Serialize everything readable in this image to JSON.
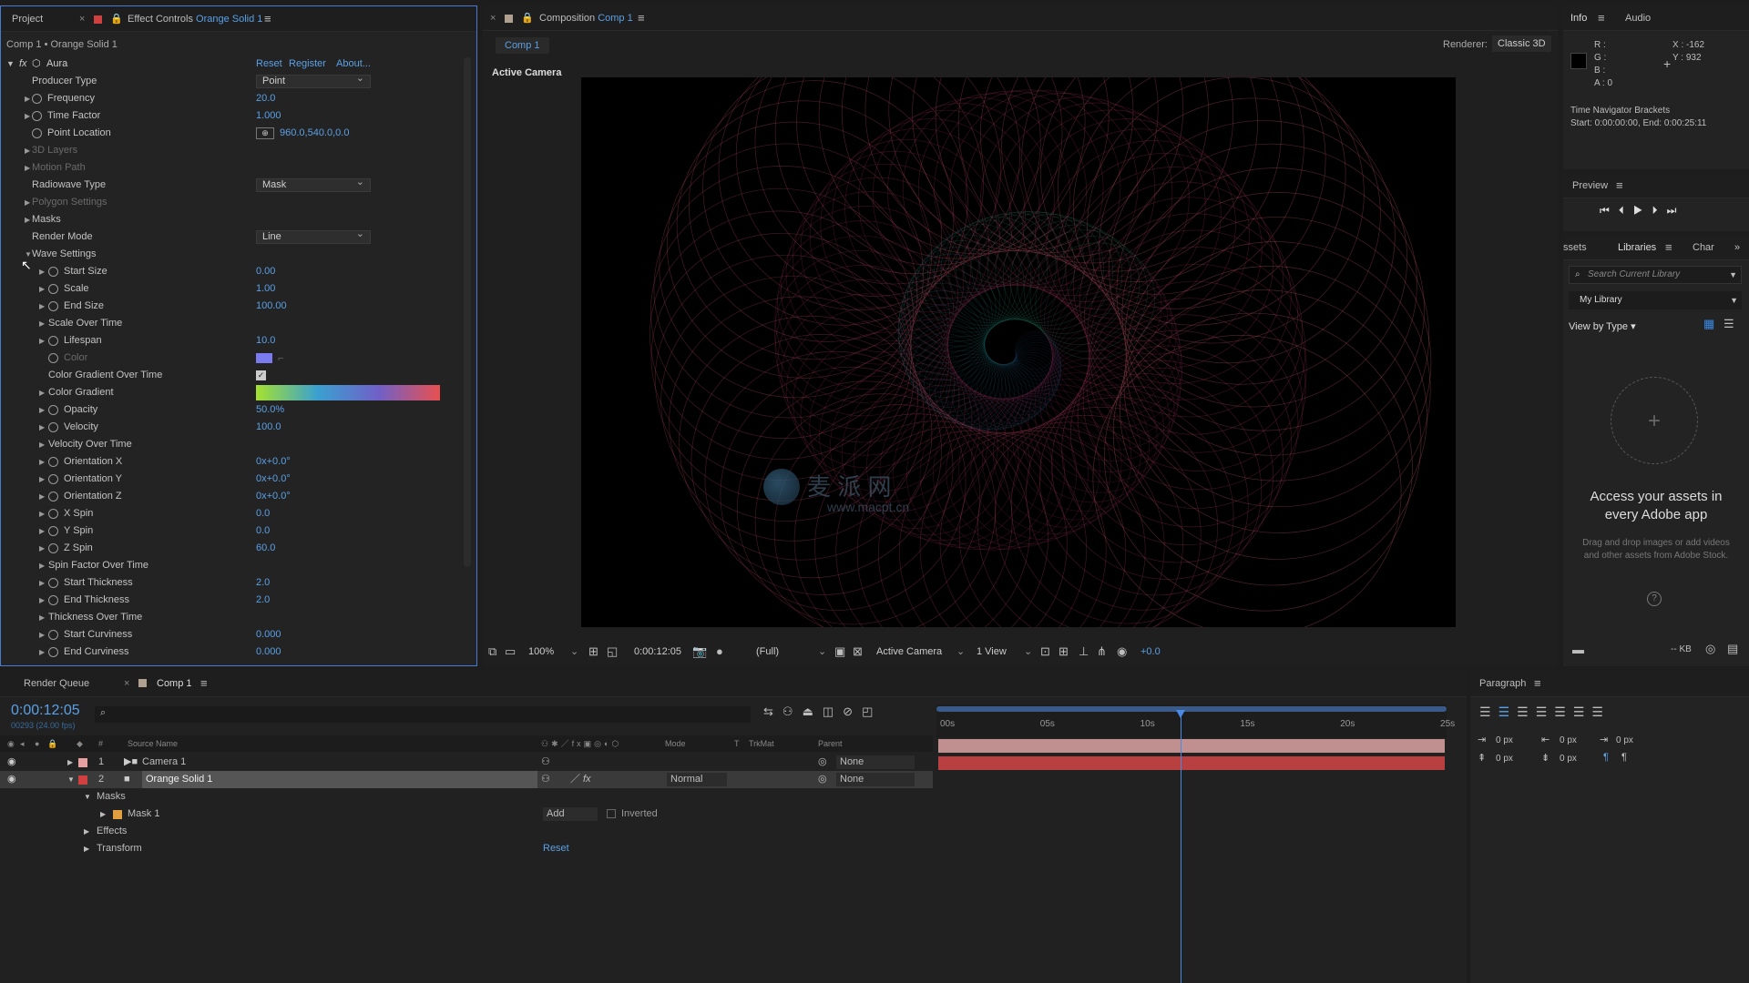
{
  "effect_controls": {
    "tab_project": "Project",
    "tab_title": "Effect Controls",
    "tab_layer": "Orange Solid 1",
    "breadcrumb": "Comp 1 • Orange Solid 1",
    "fx_label": "fx",
    "effect_name": "Aura",
    "reset": "Reset",
    "register": "Register",
    "about": "About...",
    "rows": [
      {
        "name": "Producer Type",
        "dropdown": "Point"
      },
      {
        "name": "Frequency",
        "value": "20.0"
      },
      {
        "name": "Time Factor",
        "value": "1.000"
      },
      {
        "name": "Point Location",
        "value": "960.0,540.0,0.0"
      },
      {
        "name": "3D Layers"
      },
      {
        "name": "Motion Path"
      },
      {
        "name": "Radiowave Type",
        "dropdown": "Mask"
      },
      {
        "name": "Polygon Settings"
      },
      {
        "name": "Masks"
      },
      {
        "name": "Render Mode",
        "dropdown": "Line"
      },
      {
        "name": "Wave Settings"
      },
      {
        "name": "Start Size",
        "value": "0.00"
      },
      {
        "name": "Scale",
        "value": "1.00"
      },
      {
        "name": "End Size",
        "value": "100.00"
      },
      {
        "name": "Scale Over Time"
      },
      {
        "name": "Lifespan",
        "value": "10.0"
      },
      {
        "name": "Color"
      },
      {
        "name": "Color Gradient Over Time"
      },
      {
        "name": "Color Gradient"
      },
      {
        "name": "Opacity",
        "value": "50.0%"
      },
      {
        "name": "Velocity",
        "value": "100.0"
      },
      {
        "name": "Velocity Over Time"
      },
      {
        "name": "Orientation X",
        "value": "0x+0.0°"
      },
      {
        "name": "Orientation Y",
        "value": "0x+0.0°"
      },
      {
        "name": "Orientation Z",
        "value": "0x+0.0°"
      },
      {
        "name": "X Spin",
        "value": "0.0"
      },
      {
        "name": "Y Spin",
        "value": "0.0"
      },
      {
        "name": "Z Spin",
        "value": "60.0"
      },
      {
        "name": "Spin Factor Over Time"
      },
      {
        "name": "Start Thickness",
        "value": "2.0"
      },
      {
        "name": "End Thickness",
        "value": "2.0"
      },
      {
        "name": "Thickness Over Time"
      },
      {
        "name": "Start Curviness",
        "value": "0.000"
      },
      {
        "name": "End Curviness",
        "value": "0.000"
      }
    ],
    "color_swatch": "#7b7bf0",
    "gradient_colors": [
      "#a6e22e",
      "#3aa0d0",
      "#7060c8",
      "#e85050"
    ]
  },
  "composition": {
    "tab_prefix": "Composition",
    "tab_name": "Comp 1",
    "sub_tab": "Comp 1",
    "renderer_label": "Renderer:",
    "renderer_value": "Classic 3D",
    "view_label": "Active Camera",
    "watermark_main": "麦 派 网",
    "watermark_url": "www.macpt.cn",
    "toolbar": {
      "zoom": "100%",
      "timecode": "0:00:12:05",
      "resolution": "(Full)",
      "camera": "Active Camera",
      "views": "1 View",
      "exposure": "+0.0"
    }
  },
  "info": {
    "tab_info": "Info",
    "tab_audio": "Audio",
    "r": "R :",
    "g": "G :",
    "b": "B :",
    "a": "A :  0",
    "x": "X : -162",
    "y": "Y : 932",
    "line1": "Time Navigator Brackets",
    "line2": "Start: 0:00:00:00, End: 0:00:25:11"
  },
  "preview": {
    "title": "Preview"
  },
  "libraries": {
    "tab_assets": "ssets",
    "tab_libraries": "Libraries",
    "tab_char": "Char",
    "search_placeholder": "Search Current Library",
    "library": "My Library",
    "view_by": "View by Type",
    "heading": "Access your assets in every Adobe app",
    "body": "Drag and drop images or add videos and other assets from Adobe Stock.",
    "size": "-- KB"
  },
  "timeline": {
    "tab_render_queue": "Render Queue",
    "tab_comp": "Comp 1",
    "timecode": "0:00:12:05",
    "frames": "00293 (24.00 fps)",
    "col_hash": "#",
    "col_source": "Source Name",
    "col_mode": "Mode",
    "col_t": "T",
    "col_trkmat": "TrkMat",
    "col_parent": "Parent",
    "layers": [
      {
        "num": "1",
        "name": "Camera 1",
        "color": "#e8a0a0",
        "parent": "None"
      },
      {
        "num": "2",
        "name": "Orange Solid 1",
        "color": "#d04040",
        "mode": "Normal",
        "parent": "None"
      }
    ],
    "sub": {
      "masks": "Masks",
      "mask1": "Mask 1",
      "add": "Add",
      "inverted": "Inverted",
      "effects": "Effects",
      "transform": "Transform",
      "reset": "Reset"
    },
    "ruler": [
      "00s",
      "05s",
      "10s",
      "15s",
      "20s",
      "25s"
    ],
    "playhead_seconds": 12.2,
    "duration_seconds": 25.5
  },
  "paragraph": {
    "title": "Paragraph",
    "v1": "0 px",
    "v2": "0 px",
    "v3": "0 px",
    "v4": "0 px",
    "v5": "0 px"
  }
}
